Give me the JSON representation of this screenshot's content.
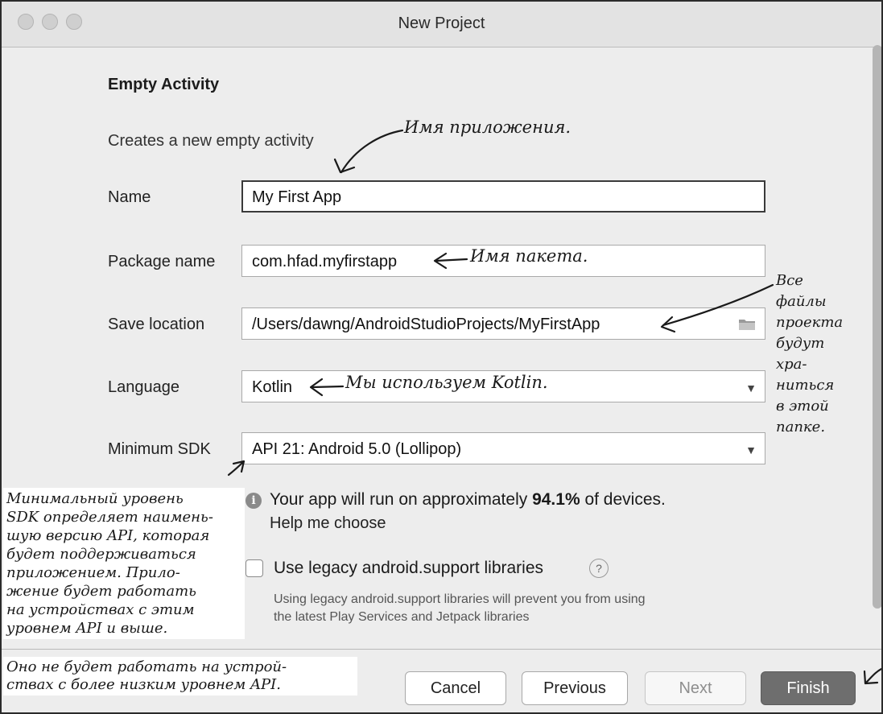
{
  "window": {
    "title": "New Project"
  },
  "template": {
    "heading": "Empty Activity",
    "description": "Creates a new empty activity"
  },
  "form": {
    "name": {
      "label": "Name",
      "value": "My First App"
    },
    "package": {
      "label": "Package name",
      "value": "com.hfad.myfirstapp"
    },
    "save_location": {
      "label": "Save location",
      "value": "/Users/dawng/AndroidStudioProjects/MyFirstApp"
    },
    "language": {
      "label": "Language",
      "value": "Kotlin"
    },
    "min_sdk": {
      "label": "Minimum SDK",
      "value": "API 21: Android 5.0 (Lollipop)"
    }
  },
  "info": {
    "prefix": "Your app will run on approximately ",
    "percent": "94.1%",
    "suffix": " of devices.",
    "help_link": "Help me choose"
  },
  "legacy": {
    "label": "Use legacy android.support libraries",
    "checked": false,
    "note_line1": "Using legacy android.support libraries will prevent you from using",
    "note_line2": "the latest Play Services and Jetpack libraries"
  },
  "buttons": {
    "cancel": "Cancel",
    "previous": "Previous",
    "next": "Next",
    "finish": "Finish"
  },
  "annotations": {
    "app_name": "Имя приложения.",
    "package": "Имя пакета.",
    "language": "Мы используем Kotlin.",
    "save_location": [
      "Все",
      "файлы",
      "проекта",
      "будут",
      "хра-",
      "ниться",
      "в этой",
      "папке."
    ],
    "min_sdk": [
      "Минимальный уровень",
      "SDK определяет наимень-",
      "шую версию API, которая",
      "будет поддерживаться",
      "приложением. Прило-",
      "жение будет работать",
      "на устройствах с этим",
      "уровнем API и выше."
    ],
    "footer": [
      "Оно не будет работать на устрой-",
      "ствах с более низким уровнем API."
    ]
  },
  "icons": {
    "info": "info-icon",
    "help": "question-icon",
    "folder": "folder-icon",
    "dropdown": "chevron-down-icon"
  }
}
